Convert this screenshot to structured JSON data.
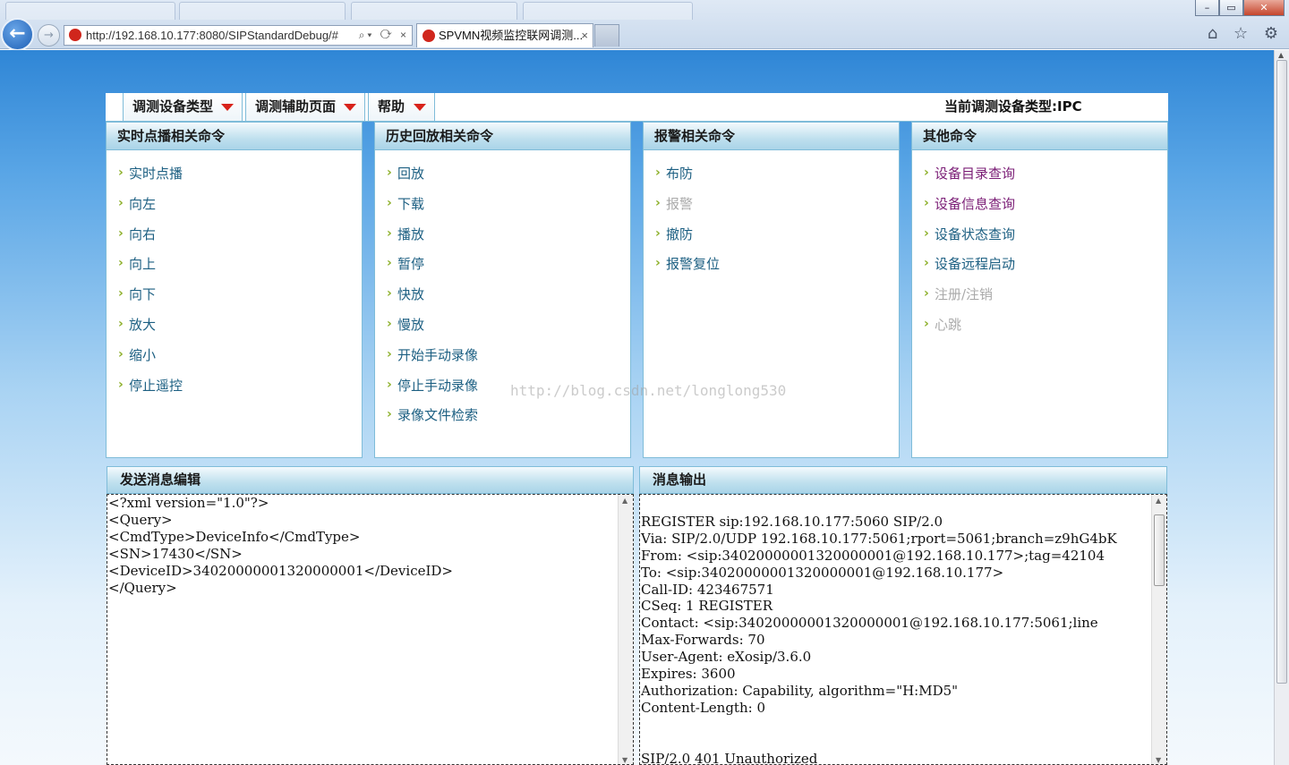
{
  "browser": {
    "url": "http://192.168.10.177:8080/SIPStandardDebug/#",
    "tab_title": "SPVMN视频监控联网调测...",
    "tab_close": "×",
    "back_glyph": "←",
    "forward_glyph": "→",
    "addr_actions": "⌕▾ ⟳ ×",
    "tool_icons": "⌂ ☆ ⚙",
    "window_buttons": {
      "minimize": "–",
      "maximize": "▭",
      "close": "✕"
    }
  },
  "menubar": {
    "items": [
      {
        "label": "调测设备类型"
      },
      {
        "label": "调测辅助页面"
      },
      {
        "label": "帮助"
      }
    ],
    "current_device": "当前调测设备类型:IPC"
  },
  "panels": [
    {
      "title": "实时点播相关命令",
      "commands": [
        {
          "label": "实时点播",
          "state": "normal"
        },
        {
          "label": "向左",
          "state": "normal"
        },
        {
          "label": "向右",
          "state": "normal"
        },
        {
          "label": "向上",
          "state": "normal"
        },
        {
          "label": "向下",
          "state": "normal"
        },
        {
          "label": "放大",
          "state": "normal"
        },
        {
          "label": "缩小",
          "state": "normal"
        },
        {
          "label": "停止遥控",
          "state": "normal"
        }
      ]
    },
    {
      "title": "历史回放相关命令",
      "commands": [
        {
          "label": "回放",
          "state": "normal"
        },
        {
          "label": "下载",
          "state": "normal"
        },
        {
          "label": "播放",
          "state": "normal"
        },
        {
          "label": "暂停",
          "state": "normal"
        },
        {
          "label": "快放",
          "state": "normal"
        },
        {
          "label": "慢放",
          "state": "normal"
        },
        {
          "label": "开始手动录像",
          "state": "normal"
        },
        {
          "label": "停止手动录像",
          "state": "normal"
        },
        {
          "label": "录像文件检索",
          "state": "normal"
        }
      ]
    },
    {
      "title": "报警相关命令",
      "commands": [
        {
          "label": "布防",
          "state": "normal"
        },
        {
          "label": "报警",
          "state": "disabled"
        },
        {
          "label": "撤防",
          "state": "normal"
        },
        {
          "label": "报警复位",
          "state": "normal"
        }
      ]
    },
    {
      "title": "其他命令",
      "commands": [
        {
          "label": "设备目录查询",
          "state": "visited"
        },
        {
          "label": "设备信息查询",
          "state": "visited"
        },
        {
          "label": "设备状态查询",
          "state": "normal"
        },
        {
          "label": "设备远程启动",
          "state": "normal"
        },
        {
          "label": "注册/注销",
          "state": "disabled"
        },
        {
          "label": "心跳",
          "state": "disabled"
        }
      ]
    }
  ],
  "send_editor": {
    "title": "发送消息编辑",
    "content": "<?xml version=\"1.0\"?>\n<Query>\n<CmdType>DeviceInfo</CmdType>\n<SN>17430</SN>\n<DeviceID>34020000001320000001</DeviceID>\n</Query>"
  },
  "output": {
    "title": "消息输出",
    "content": "\nREGISTER sip:192.168.10.177:5060 SIP/2.0\nVia: SIP/2.0/UDP 192.168.10.177:5061;rport=5061;branch=z9hG4bK\nFrom: <sip:34020000001320000001@192.168.10.177>;tag=42104\nTo: <sip:34020000001320000001@192.168.10.177>\nCall-ID: 423467571\nCSeq: 1 REGISTER\nContact: <sip:34020000001320000001@192.168.10.177:5061;line\nMax-Forwards: 70\nUser-Agent: eXosip/3.6.0\nExpires: 3600\nAuthorization: Capability, algorithm=\"H:MD5\"\nContent-Length: 0\n\n\nSIP/2.0 401 Unauthorized"
  },
  "watermark": "http://blog.csdn.net/longlong530",
  "colors": {
    "link": "#1c5f82",
    "visited": "#7a1c75",
    "disabled": "#aaaaaa",
    "caret": "#d8231b",
    "panel_border": "#7fbcd9"
  }
}
